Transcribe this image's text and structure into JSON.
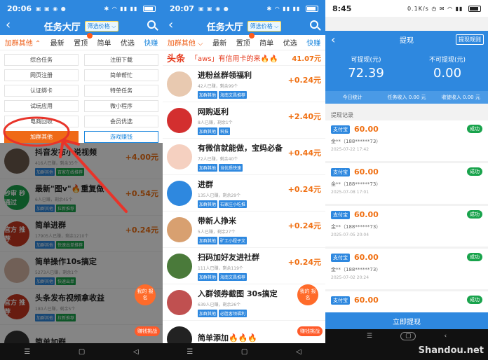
{
  "p1": {
    "time": "20:06",
    "title": "任务大厅",
    "filter": "筛选价格",
    "tabs": [
      "加群其他",
      "最新",
      "置顶",
      "简单",
      "优选",
      "快赚"
    ],
    "grid": [
      "综合任务",
      "注册下载",
      "网页注册",
      "简单帮忙",
      "认证绑卡",
      "特单任务",
      "试玩应用",
      "微小程序",
      "电商回收",
      "会员优选",
      "加群其他",
      "游戏赚钱"
    ],
    "rows": [
      {
        "title": "抖音发布小说视频",
        "sub": "416人已赚，剩余35个",
        "tags": [
          "加群其他",
          "百家在线推荐"
        ],
        "price": "+4.00元"
      },
      {
        "title": "最新\"图v\"🔥重复做",
        "sub": "6人已赚，剩余45个",
        "tags": [
          "加群其他",
          "拉新推荐"
        ],
        "price": "+0.54元"
      },
      {
        "title": "简单进群",
        "sub": "17905人已赚，剩余1210个",
        "tags": [
          "加群其他",
          "快速出单推荐"
        ],
        "price": "+0.24元"
      },
      {
        "title": "简单操作10s搞定",
        "sub": "5273人已赚，剩余1个",
        "tags": [
          "加群其他",
          "快速出单"
        ],
        "price": ""
      },
      {
        "title": "头条发布视频拿收益",
        "sub": "180人已赚，剩余5个",
        "tags": [
          "加群其他",
          "拉新推荐"
        ],
        "price": ""
      },
      {
        "title": "简单加群",
        "sub": "",
        "tags": [],
        "price": ""
      }
    ],
    "avatarTexts": [
      "",
      "秒审 秒通过",
      "官方 推荐",
      "",
      "官方 推荐",
      ""
    ],
    "fab": "我的 报名",
    "fab2": "赚钱挑战"
  },
  "p2": {
    "time": "20:07",
    "title": "任务大厅",
    "filter": "筛选价格",
    "tabs": [
      "加群其他",
      "最新",
      "置顶",
      "简单",
      "优选",
      "快赚"
    ],
    "headline": {
      "label": "头条",
      "text": "「aws」有信用卡的来🔥🔥",
      "amount": "41.07元"
    },
    "rows": [
      {
        "title": "进粉丝群领福利",
        "sub": "42人已赚，剩余99个",
        "tags": [
          "加群其他",
          "海南文昌推荐"
        ],
        "price": "+0.24元"
      },
      {
        "title": "网购返利",
        "sub": "8人已赚，剩余1个",
        "tags": [
          "加群其他",
          "科技"
        ],
        "price": "+2.40元"
      },
      {
        "title": "有微信就能做，宝妈必备",
        "sub": "72人已赚，剩余40个",
        "tags": [
          "加群其他",
          "当优质快速"
        ],
        "price": "+0.44元"
      },
      {
        "title": "进群",
        "sub": "135人已赚，剩余29个",
        "tags": [
          "加群其他",
          "石家庄小吃推"
        ],
        "price": "+0.24元"
      },
      {
        "title": "带新人挣米",
        "sub": "5人已赚，剩余27个",
        "tags": [
          "加群其他",
          "矿工小程子文"
        ],
        "price": "+0.24元"
      },
      {
        "title": "扫码加好友进社群",
        "sub": "111人已赚，剩余119个",
        "tags": [
          "加群其他",
          "海南文昌推荐"
        ],
        "price": "+0.24元"
      },
      {
        "title": "入群领券截图 30s搞定",
        "sub": "639人已赚，剩余26个",
        "tags": [
          "加群其他",
          "必胜客领福利"
        ],
        "price": ""
      },
      {
        "title": "简单添加🔥🔥🔥",
        "sub": "",
        "tags": [],
        "price": ""
      }
    ],
    "fab": "我的 报名",
    "fab2": "赚钱挑战"
  },
  "p3": {
    "time": "8:45",
    "net": "0.1K/s",
    "title": "提现",
    "rule": "提现规则",
    "avail_label": "可提现(元)",
    "avail": "72.39",
    "unavail_label": "不可提现(元)",
    "unavail": "0.00",
    "stats": [
      "今日统计",
      "任务收入 0.00 元",
      "收徒收入 0.00 元"
    ],
    "record_label": "提现记录",
    "records": [
      {
        "pay": "支付宝",
        "amount": "60.00",
        "status": "成功",
        "acct": "金**（188******73）",
        "date": "2025-07-22 17:42"
      },
      {
        "pay": "支付宝",
        "amount": "60.00",
        "status": "成功",
        "acct": "金**（188******73）",
        "date": "2025-07-08 17:01"
      },
      {
        "pay": "支付宝",
        "amount": "60.00",
        "status": "成功",
        "acct": "金**（188******73）",
        "date": "2025-07-05 20:04"
      },
      {
        "pay": "支付宝",
        "amount": "60.00",
        "status": "成功",
        "acct": "金**（188******73）",
        "date": "2025-07-02 20:24"
      },
      {
        "pay": "支付宝",
        "amount": "60.00",
        "status": "成功",
        "acct": "",
        "date": ""
      }
    ],
    "withdraw": "立即提现"
  },
  "watermark": "Shandou.net",
  "colors": {
    "blue": "#2e88df",
    "orange": "#f07013",
    "green": "#19a34c"
  }
}
